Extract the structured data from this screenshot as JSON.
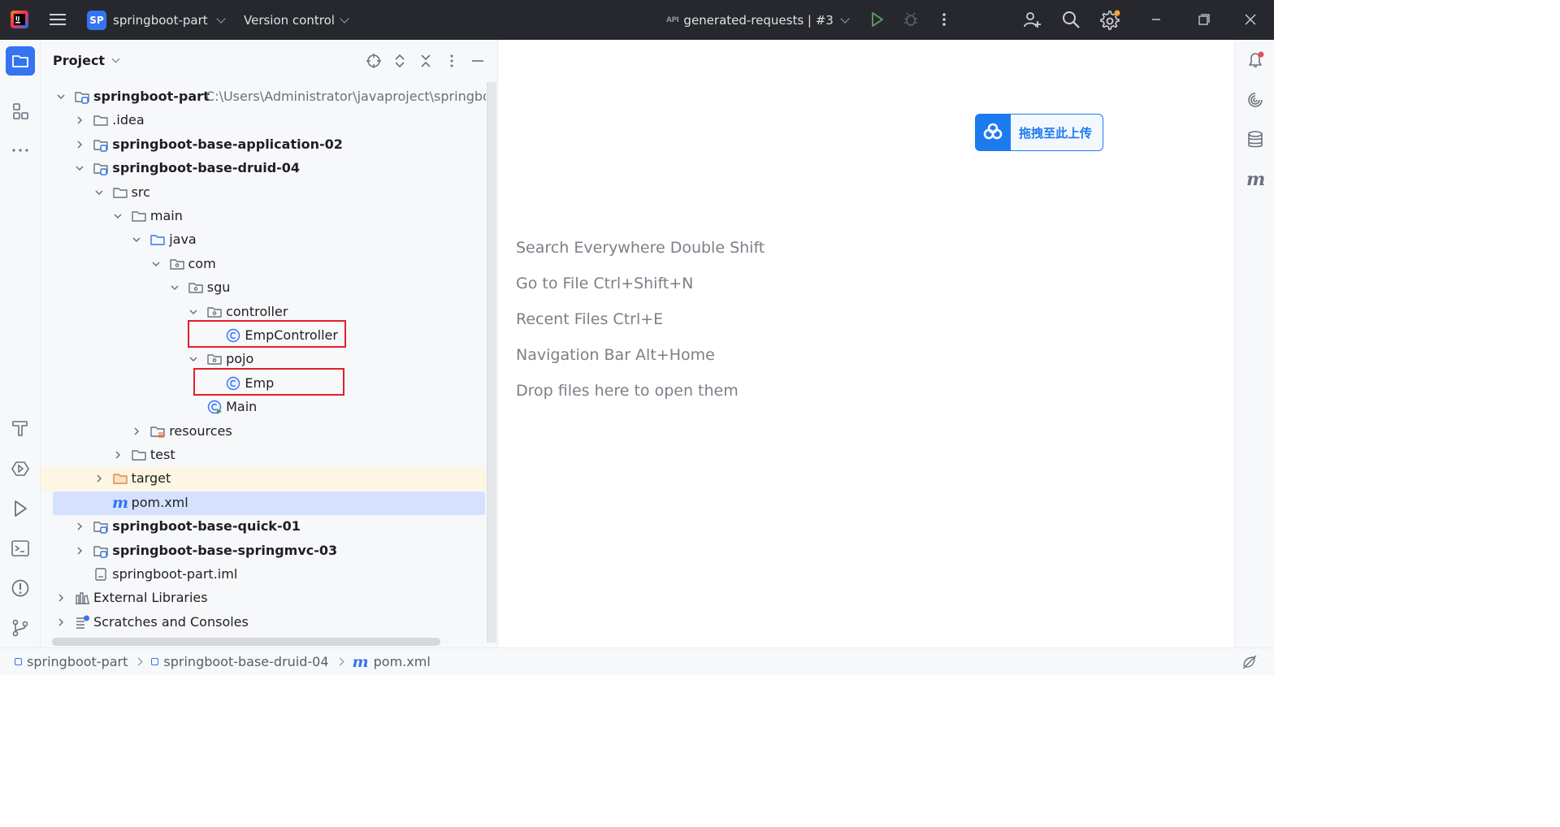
{
  "titlebar": {
    "project_badge": "SP",
    "project_name": "springboot-part",
    "version_control": "Version control",
    "run_config": "generated-requests | #3",
    "api_badge": "API"
  },
  "panel": {
    "title": "Project",
    "tree": [
      {
        "label": "springboot-part",
        "bold": true,
        "path": "C:\\Users\\Administrator\\javaproject\\springboot-part",
        "icon": "module-folder-icon",
        "arrow": "expanded"
      },
      {
        "label": ".idea",
        "icon": "folder-icon",
        "arrow": "collapsed"
      },
      {
        "label": "springboot-base-application-02",
        "bold": true,
        "icon": "module-folder-icon",
        "arrow": "collapsed"
      },
      {
        "label": "springboot-base-druid-04",
        "bold": true,
        "icon": "module-folder-icon",
        "arrow": "expanded"
      },
      {
        "label": "src",
        "icon": "folder-icon",
        "arrow": "expanded"
      },
      {
        "label": "main",
        "icon": "folder-icon",
        "arrow": "expanded"
      },
      {
        "label": "java",
        "icon": "source-folder-icon",
        "arrow": "expanded"
      },
      {
        "label": "com",
        "icon": "package-icon",
        "arrow": "expanded"
      },
      {
        "label": "sgu",
        "icon": "package-icon",
        "arrow": "expanded"
      },
      {
        "label": "controller",
        "icon": "package-icon",
        "arrow": "expanded"
      },
      {
        "label": "EmpController",
        "icon": "class-icon"
      },
      {
        "label": "pojo",
        "icon": "package-icon",
        "arrow": "expanded"
      },
      {
        "label": "Emp",
        "icon": "class-icon"
      },
      {
        "label": "Main",
        "icon": "main-class-icon"
      },
      {
        "label": "resources",
        "icon": "resources-folder-icon",
        "arrow": "collapsed"
      },
      {
        "label": "test",
        "icon": "folder-icon",
        "arrow": "collapsed"
      },
      {
        "label": "target",
        "icon": "excluded-folder-icon",
        "arrow": "collapsed"
      },
      {
        "label": "pom.xml",
        "icon": "maven-icon"
      },
      {
        "label": "springboot-base-quick-01",
        "bold": true,
        "icon": "module-folder-icon",
        "arrow": "collapsed"
      },
      {
        "label": "springboot-base-springmvc-03",
        "bold": true,
        "icon": "module-folder-icon",
        "arrow": "collapsed"
      },
      {
        "label": "springboot-part.iml",
        "icon": "iml-file-icon"
      },
      {
        "label": "External Libraries",
        "icon": "libraries-icon",
        "arrow": "collapsed"
      },
      {
        "label": "Scratches and Consoles",
        "icon": "scratches-icon",
        "arrow": "collapsed"
      }
    ]
  },
  "editor": {
    "upload_label": "拖拽至此上传",
    "hints": [
      "Search Everywhere Double Shift",
      "Go to File Ctrl+Shift+N",
      "Recent Files Ctrl+E",
      "Navigation Bar Alt+Home",
      "Drop files here to open them"
    ]
  },
  "statusbar": {
    "crumbs": [
      "springboot-part",
      "springboot-base-druid-04",
      "pom.xml"
    ]
  },
  "colors": {
    "accent": "#3574f0",
    "highlight_box": "#e0202a",
    "selection": "#d5e1ff",
    "excluded_row": "#fdf6e3",
    "upload_blue": "#1d7bf0"
  }
}
